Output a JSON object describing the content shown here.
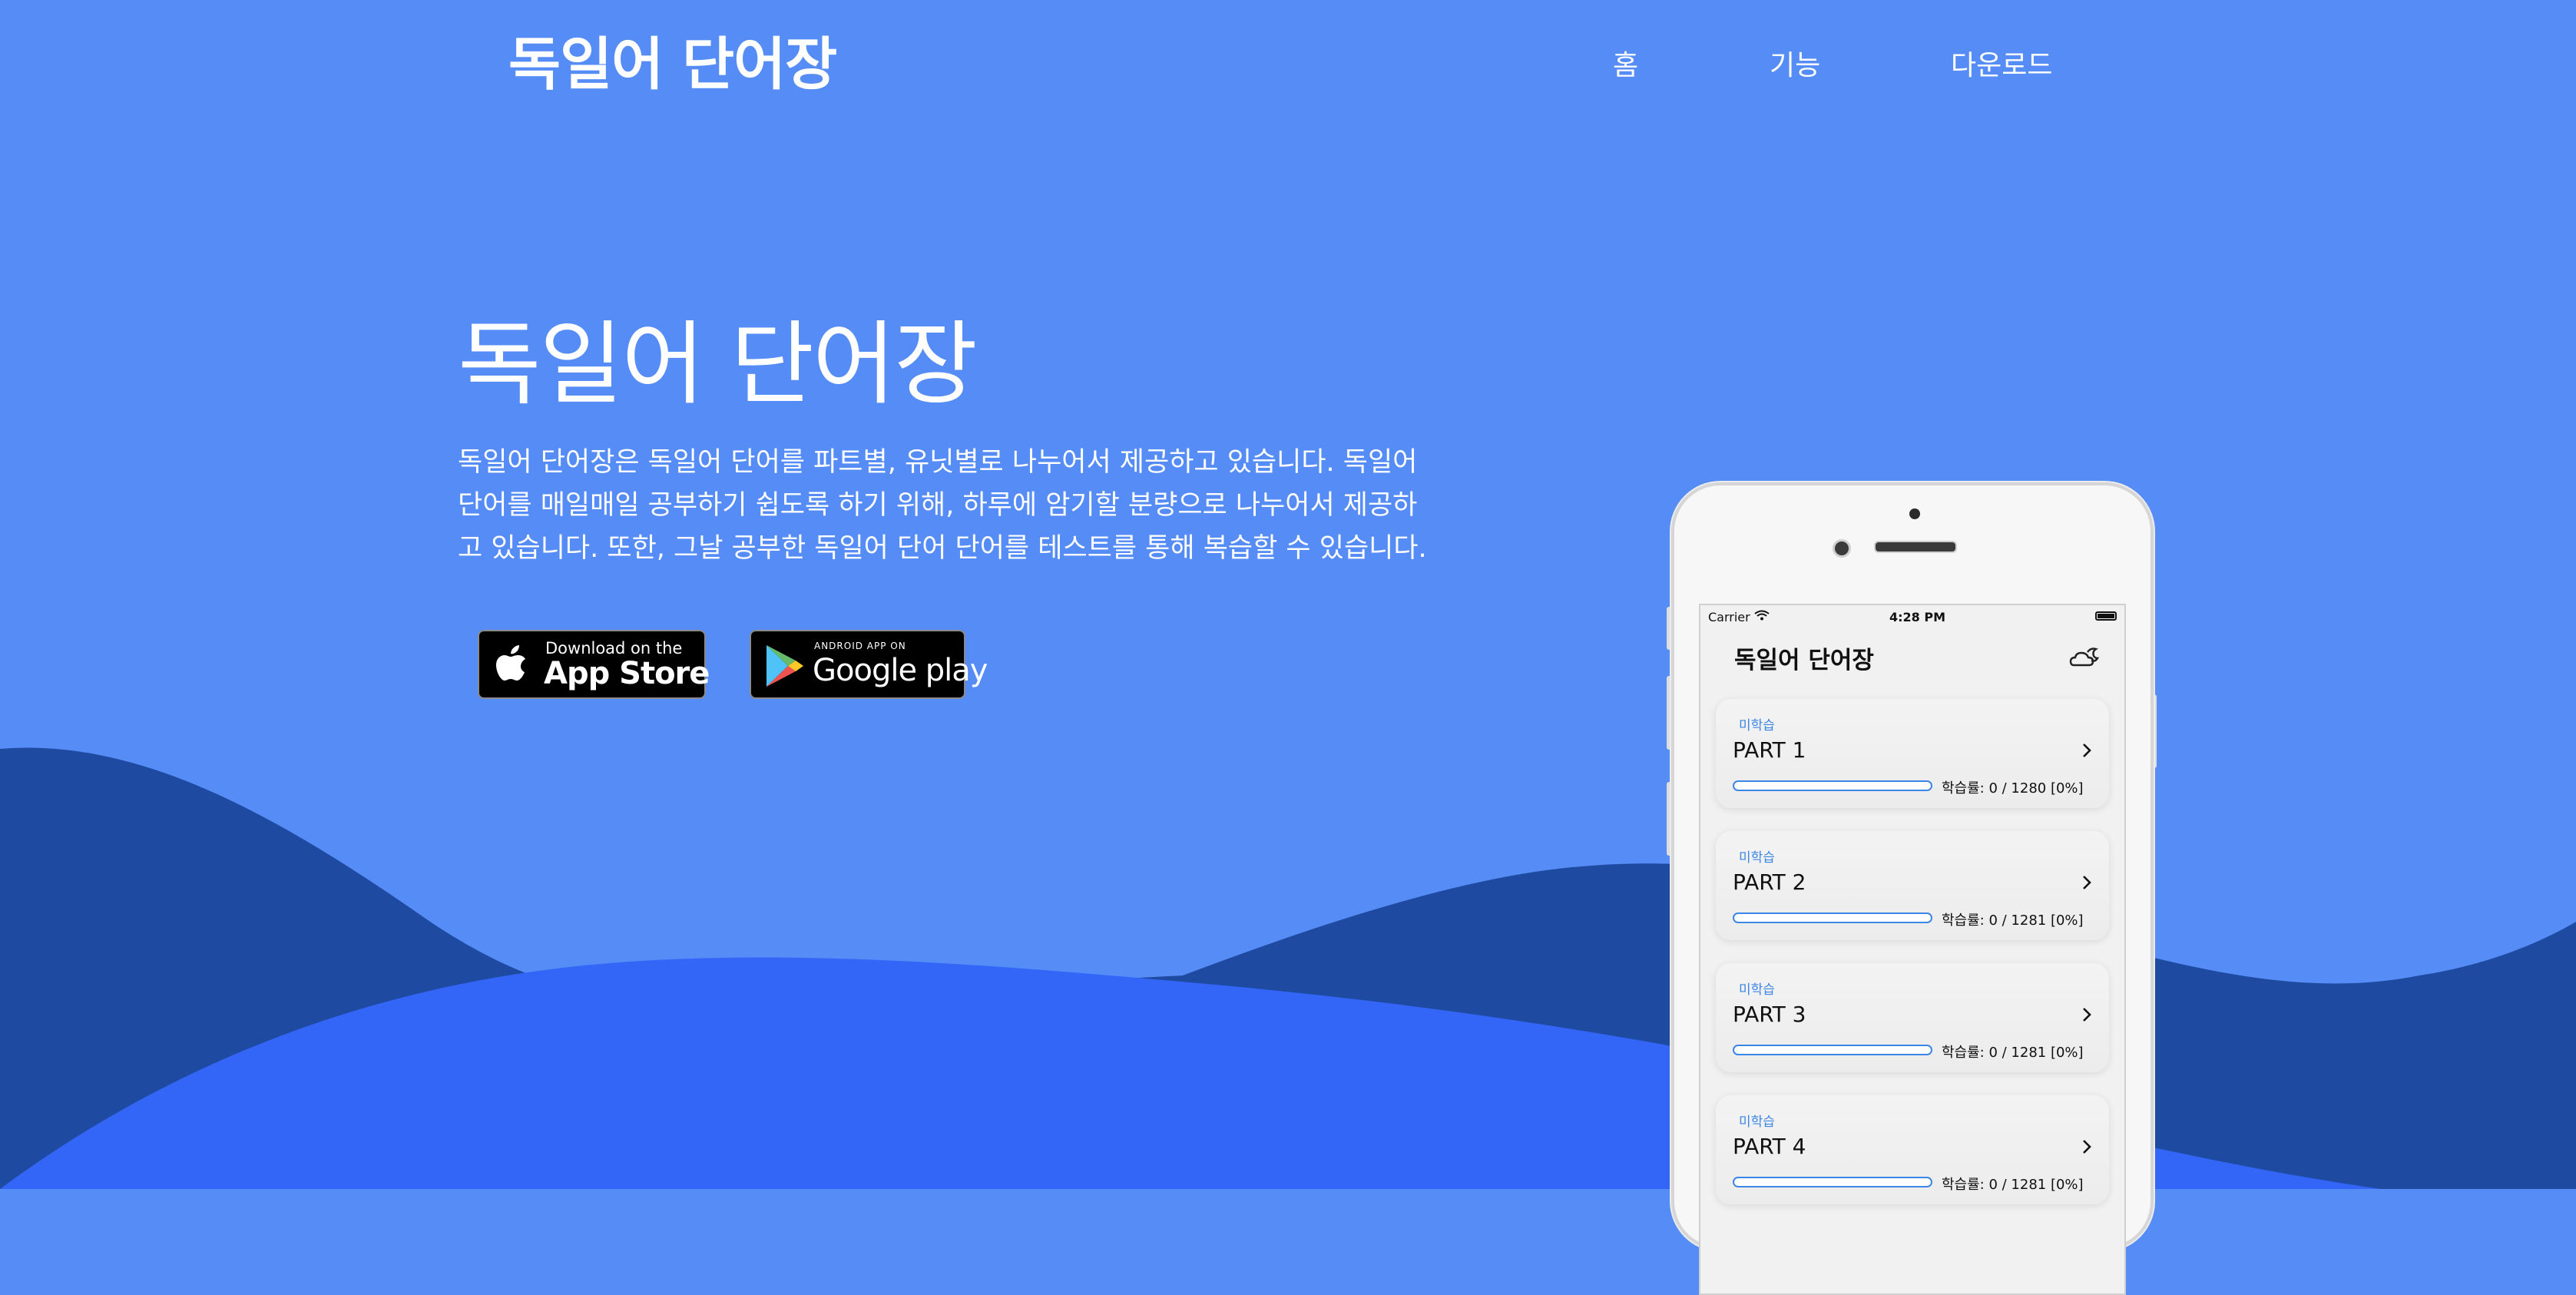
{
  "colors": {
    "background": "#558cf6",
    "wave_dark": "#1f4aa1",
    "wave_mid": "#3366f6",
    "accent_blue": "#3c86e6"
  },
  "nav": {
    "brand": "독일어 단어장",
    "links": [
      "홈",
      "기능",
      "다운로드"
    ]
  },
  "hero": {
    "title": "독일어 단어장",
    "description": "독일어 단어장은 독일어 단어를 파트별, 유닛별로 나누어서 제공하고 있습니다. 독일어 단어를 매일매일 공부하기 쉽도록 하기 위해, 하루에 암기할 분량으로 나누어서 제공하고 있습니다. 또한, 그날 공부한 독일어 단어 단어를 테스트를 통해 복습할 수 있습니다."
  },
  "store_buttons": {
    "app_store": {
      "small": "Download on the",
      "big": "App Store",
      "icon": "apple-icon"
    },
    "google_play": {
      "small": "ANDROID APP ON",
      "big": "Google play",
      "icon": "play-icon"
    }
  },
  "phone": {
    "status_bar": {
      "carrier": "Carrier",
      "time": "4:28 PM"
    },
    "app_title": "독일어 단어장",
    "theme_icon": "cloud-moon-icon",
    "parts": [
      {
        "status": "미학습",
        "title": "PART 1",
        "progress_text": "학습률: 0 / 1280 [0%]",
        "progress": 0
      },
      {
        "status": "미학습",
        "title": "PART 2",
        "progress_text": "학습률: 0 / 1281 [0%]",
        "progress": 0
      },
      {
        "status": "미학습",
        "title": "PART 3",
        "progress_text": "학습률: 0 / 1281 [0%]",
        "progress": 0
      },
      {
        "status": "미학습",
        "title": "PART 4",
        "progress_text": "학습률: 0 / 1281 [0%]",
        "progress": 0
      }
    ]
  }
}
